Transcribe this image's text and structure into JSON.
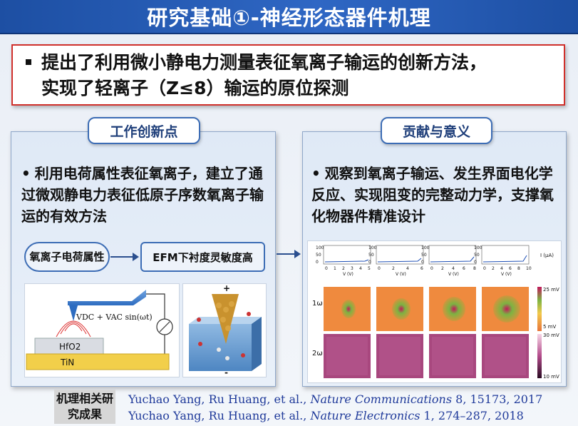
{
  "title": "研究基础①-神经形态器件机理",
  "highlight": {
    "line1": "提出了利用微小静电力测量表征氧离子输运的创新方法，",
    "line2": "实现了轻离子（Z≤8）输运的原位探测"
  },
  "left_panel": {
    "tag": "工作创新点",
    "bullet": "•",
    "text": "利用电荷属性表征氧离子，建立了通过微观静电力表征低原子序数氧离子输运的有效方法",
    "flow": {
      "oval": "氧离子电荷属性",
      "rect": "EFM下衬度灵敏度高"
    },
    "figure_left": {
      "formula_vdc": "V",
      "formula_text": "VDC + VAC sin(ωt)",
      "layer_top": "HfO2",
      "layer_bottom": "TiN"
    },
    "figure_right": {
      "plus": "+",
      "minus": "-"
    }
  },
  "right_panel": {
    "tag": "贡献与意义",
    "bullet": "•",
    "text": "观察到氧离子输运、发生界面电化学反应、实现阻变的完整动力学，支撑氧化物器件精准设计",
    "figure": {
      "row1_label": "1ω",
      "row2_label": "2ω",
      "colorbar1_top": "25 mV",
      "colorbar1_bottom": "5 mV",
      "colorbar2_top": "30 mV",
      "colorbar2_bottom": "10 mV",
      "unit": "I (μA)",
      "x_label": "V (V)",
      "y_ticks": [
        "100",
        "50",
        "0"
      ],
      "x_ticks_sets": [
        [
          "0",
          "1",
          "2",
          "3",
          "4",
          "5"
        ],
        [
          "0",
          "2",
          "4",
          "6"
        ],
        [
          "0",
          "2",
          "4",
          "6",
          "8"
        ],
        [
          "0",
          "2",
          "4",
          "6",
          "8",
          "10"
        ]
      ]
    }
  },
  "references": {
    "label": "机理相关研究成果",
    "ref1_authors": "Yuchao Yang, Ru Huang, et al., ",
    "ref1_journal": "Nature Communications",
    "ref1_rest": " 8, 15173, 2017",
    "ref2_authors": "Yuchao Yang, Ru Huang, et al., ",
    "ref2_journal": "Nature Electronics",
    "ref2_rest": " 1, 274–287, 2018"
  }
}
